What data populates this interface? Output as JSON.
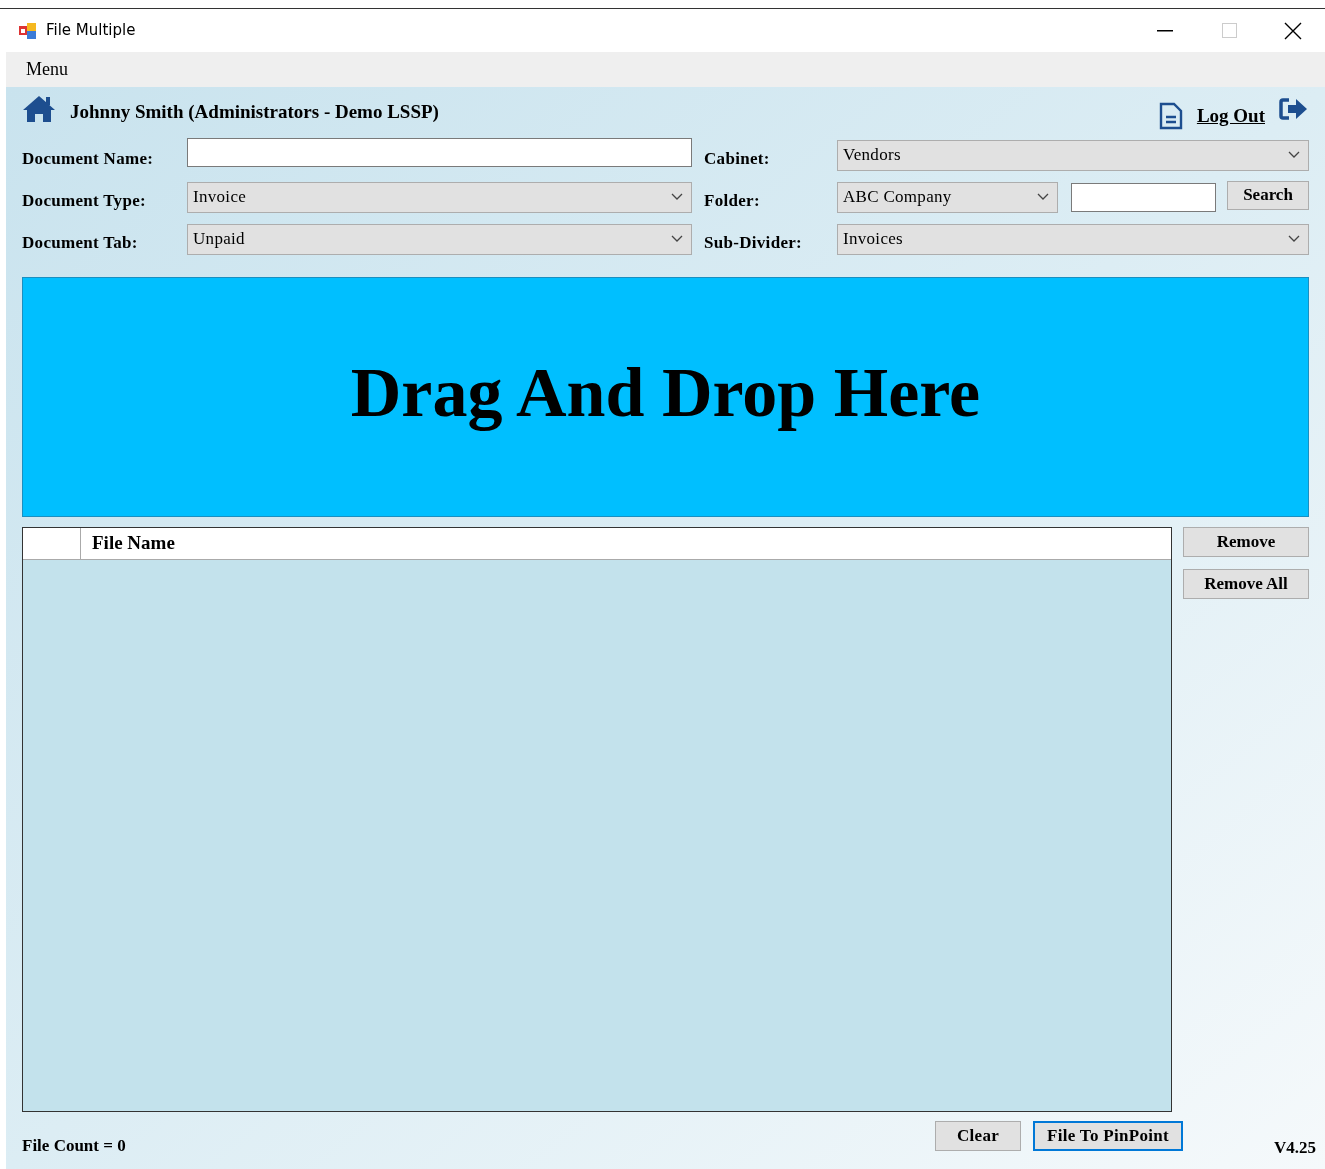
{
  "window": {
    "title": "File Multiple",
    "maximize_disabled": true
  },
  "menu_bar": {
    "items": [
      "Menu"
    ]
  },
  "header": {
    "user": "Johnny Smith (Administrators - Demo LSSP)",
    "logout": "Log Out"
  },
  "form": {
    "left": [
      {
        "kind": "text",
        "label": "Document Name:"
      },
      {
        "kind": "dropdown",
        "label": "Document Type:",
        "value": "Invoice"
      },
      {
        "kind": "dropdown",
        "label": "Document Tab:",
        "value": "Unpaid"
      }
    ],
    "right": [
      {
        "kind": "dropdown",
        "label": "Cabinet:",
        "value": "Vendors"
      },
      {
        "kind": "folder",
        "label": "Folder:",
        "value": "ABC Company",
        "button": "Search"
      },
      {
        "kind": "dropdown",
        "label": "Sub-Divider:",
        "value": "Invoices"
      }
    ]
  },
  "drop_zone": {
    "text": "Drag And Drop Here"
  },
  "table": {
    "columns": [
      "File Name"
    ]
  },
  "side_buttons": [
    "Remove",
    "Remove All"
  ],
  "footer": {
    "file_count": "File Count = 0",
    "buttons": [
      {
        "label": "Clear",
        "focused": false
      },
      {
        "label": "File To PinPoint",
        "focused": true
      }
    ],
    "version": "V4.25"
  }
}
